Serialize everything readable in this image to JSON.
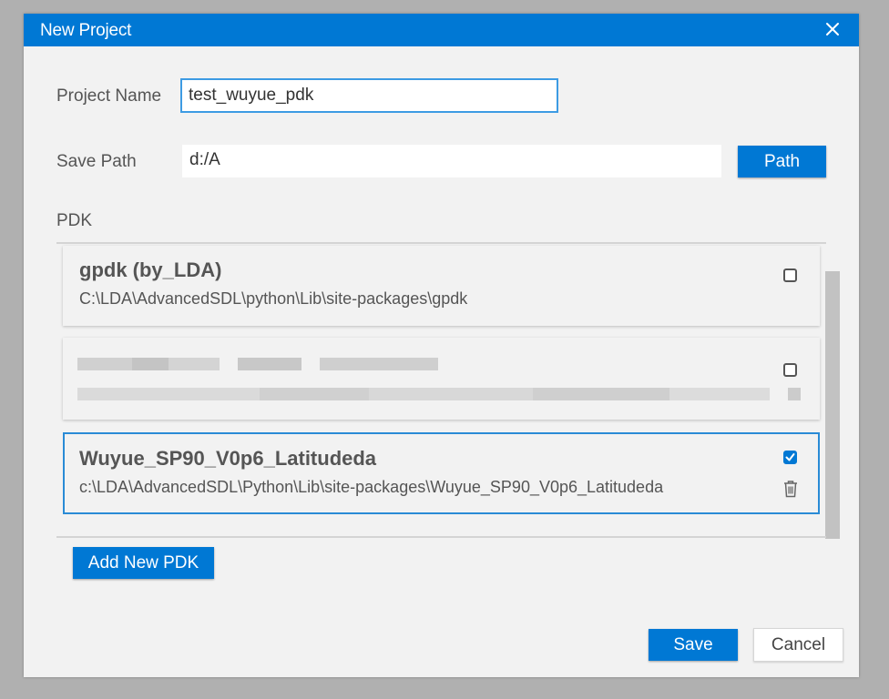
{
  "dialog": {
    "title": "New Project",
    "close_icon": "close-icon"
  },
  "form": {
    "project_name_label": "Project Name",
    "project_name_value": "test_wuyue_pdk",
    "save_path_label": "Save Path",
    "save_path_value": "d:/A",
    "path_button": "Path",
    "pdk_label": "PDK"
  },
  "pdks": [
    {
      "name": "gpdk (by_LDA)",
      "path": "C:\\LDA\\AdvancedSDL\\python\\Lib\\site-packages\\gpdk",
      "checked": false
    },
    {
      "name": "",
      "path": "",
      "checked": false,
      "redacted": true
    },
    {
      "name": "Wuyue_SP90_V0p6_Latitudeda",
      "path": "c:\\LDA\\AdvancedSDL\\Python\\Lib\\site-packages\\Wuyue_SP90_V0p6_Latitudeda",
      "checked": true,
      "selected": true
    }
  ],
  "footer": {
    "add_pdk_button": "Add New PDK",
    "save_button": "Save",
    "cancel_button": "Cancel"
  },
  "colors": {
    "accent": "#0078d4",
    "dialog_bg": "#f2f2f2",
    "backdrop": "#b0b0b0"
  }
}
